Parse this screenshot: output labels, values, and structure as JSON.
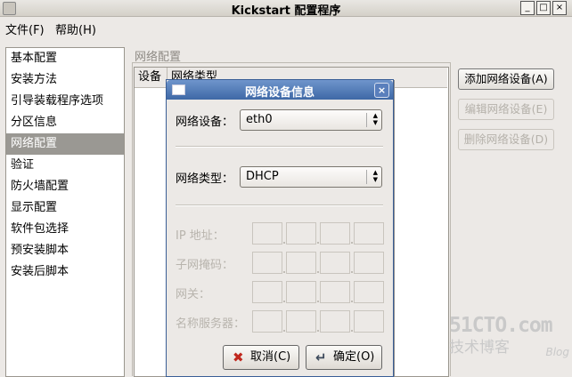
{
  "window": {
    "title": "Kickstart 配置程序",
    "controls": [
      "_",
      "□",
      "×"
    ]
  },
  "menu": [
    {
      "label": "文件(F)"
    },
    {
      "label": "帮助(H)"
    }
  ],
  "sidebar": {
    "items": [
      "基本配置",
      "安装方法",
      "引导装载程序选项",
      "分区信息",
      "网络配置",
      "验证",
      "防火墙配置",
      "显示配置",
      "软件包选择",
      "预安装脚本",
      "安装后脚本"
    ],
    "selected": "网络配置"
  },
  "panel": {
    "title": "网络配置",
    "columns": [
      "设备",
      "网络类型"
    ],
    "buttons": [
      {
        "label": "添加网络设备(A)",
        "enabled": true
      },
      {
        "label": "编辑网络设备(E)",
        "enabled": false
      },
      {
        "label": "删除网络设备(D)",
        "enabled": false
      }
    ]
  },
  "dialog": {
    "title": "网络设备信息",
    "close_icon": "×",
    "device_label": "网络设备：",
    "device_value": "eth0",
    "type_label": "网络类型：",
    "type_value": "DHCP",
    "ip_label": "IP 地址：",
    "netmask_label": "子网掩码：",
    "gateway_label": "网关：",
    "dns_label": "名称服务器：",
    "cancel_label": "取消(C)",
    "ok_label": "确定(O)"
  },
  "watermark": {
    "line1": "51CTO.com",
    "line2": "技术博客",
    "line3": "Blog"
  },
  "colors": {
    "dialog_title_bg": "#4a72b0",
    "selection_bg": "#9a9893"
  }
}
